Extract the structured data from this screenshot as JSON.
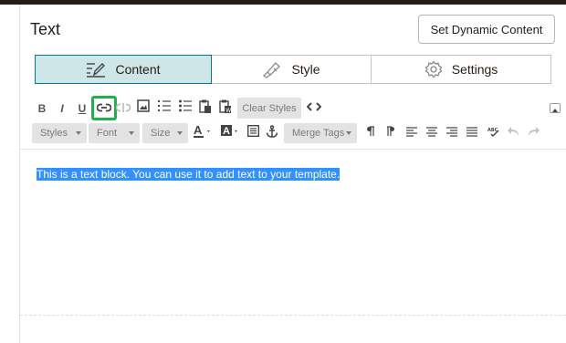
{
  "panel": {
    "title": "Text",
    "dynamic_button": "Set Dynamic Content"
  },
  "tabs": [
    {
      "label": "Content",
      "icon": "edit-icon",
      "active": true
    },
    {
      "label": "Style",
      "icon": "paint-icon",
      "active": false
    },
    {
      "label": "Settings",
      "icon": "gear-icon",
      "active": false
    }
  ],
  "toolbar": {
    "bold": "B",
    "italic": "I",
    "underline": "U",
    "clear_styles": "Clear Styles",
    "styles": "Styles",
    "font": "Font",
    "size": "Size",
    "merge_tags": "Merge Tags",
    "highlighted_icon": "link-icon"
  },
  "editor": {
    "text": "This is a text block. You can use it to add text to your template."
  },
  "colors": {
    "accent": "#007c89",
    "active_tab_bg": "#cfe6e8",
    "highlight": "#1fb14b",
    "selection": "#3390ff"
  }
}
